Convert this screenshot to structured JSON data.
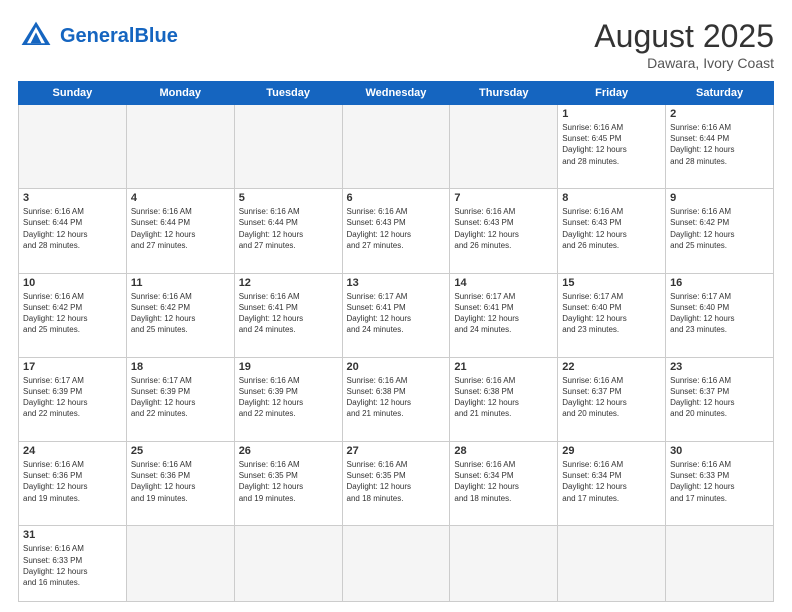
{
  "header": {
    "logo_general": "General",
    "logo_blue": "Blue",
    "month_year": "August 2025",
    "location": "Dawara, Ivory Coast"
  },
  "days_of_week": [
    "Sunday",
    "Monday",
    "Tuesday",
    "Wednesday",
    "Thursday",
    "Friday",
    "Saturday"
  ],
  "weeks": [
    [
      {
        "day": "",
        "info": "",
        "empty": true
      },
      {
        "day": "",
        "info": "",
        "empty": true
      },
      {
        "day": "",
        "info": "",
        "empty": true
      },
      {
        "day": "",
        "info": "",
        "empty": true
      },
      {
        "day": "",
        "info": "",
        "empty": true
      },
      {
        "day": "1",
        "info": "Sunrise: 6:16 AM\nSunset: 6:45 PM\nDaylight: 12 hours\nand 28 minutes.",
        "empty": false
      },
      {
        "day": "2",
        "info": "Sunrise: 6:16 AM\nSunset: 6:44 PM\nDaylight: 12 hours\nand 28 minutes.",
        "empty": false
      }
    ],
    [
      {
        "day": "3",
        "info": "Sunrise: 6:16 AM\nSunset: 6:44 PM\nDaylight: 12 hours\nand 28 minutes.",
        "empty": false
      },
      {
        "day": "4",
        "info": "Sunrise: 6:16 AM\nSunset: 6:44 PM\nDaylight: 12 hours\nand 27 minutes.",
        "empty": false
      },
      {
        "day": "5",
        "info": "Sunrise: 6:16 AM\nSunset: 6:44 PM\nDaylight: 12 hours\nand 27 minutes.",
        "empty": false
      },
      {
        "day": "6",
        "info": "Sunrise: 6:16 AM\nSunset: 6:43 PM\nDaylight: 12 hours\nand 27 minutes.",
        "empty": false
      },
      {
        "day": "7",
        "info": "Sunrise: 6:16 AM\nSunset: 6:43 PM\nDaylight: 12 hours\nand 26 minutes.",
        "empty": false
      },
      {
        "day": "8",
        "info": "Sunrise: 6:16 AM\nSunset: 6:43 PM\nDaylight: 12 hours\nand 26 minutes.",
        "empty": false
      },
      {
        "day": "9",
        "info": "Sunrise: 6:16 AM\nSunset: 6:42 PM\nDaylight: 12 hours\nand 25 minutes.",
        "empty": false
      }
    ],
    [
      {
        "day": "10",
        "info": "Sunrise: 6:16 AM\nSunset: 6:42 PM\nDaylight: 12 hours\nand 25 minutes.",
        "empty": false
      },
      {
        "day": "11",
        "info": "Sunrise: 6:16 AM\nSunset: 6:42 PM\nDaylight: 12 hours\nand 25 minutes.",
        "empty": false
      },
      {
        "day": "12",
        "info": "Sunrise: 6:16 AM\nSunset: 6:41 PM\nDaylight: 12 hours\nand 24 minutes.",
        "empty": false
      },
      {
        "day": "13",
        "info": "Sunrise: 6:17 AM\nSunset: 6:41 PM\nDaylight: 12 hours\nand 24 minutes.",
        "empty": false
      },
      {
        "day": "14",
        "info": "Sunrise: 6:17 AM\nSunset: 6:41 PM\nDaylight: 12 hours\nand 24 minutes.",
        "empty": false
      },
      {
        "day": "15",
        "info": "Sunrise: 6:17 AM\nSunset: 6:40 PM\nDaylight: 12 hours\nand 23 minutes.",
        "empty": false
      },
      {
        "day": "16",
        "info": "Sunrise: 6:17 AM\nSunset: 6:40 PM\nDaylight: 12 hours\nand 23 minutes.",
        "empty": false
      }
    ],
    [
      {
        "day": "17",
        "info": "Sunrise: 6:17 AM\nSunset: 6:39 PM\nDaylight: 12 hours\nand 22 minutes.",
        "empty": false
      },
      {
        "day": "18",
        "info": "Sunrise: 6:17 AM\nSunset: 6:39 PM\nDaylight: 12 hours\nand 22 minutes.",
        "empty": false
      },
      {
        "day": "19",
        "info": "Sunrise: 6:16 AM\nSunset: 6:39 PM\nDaylight: 12 hours\nand 22 minutes.",
        "empty": false
      },
      {
        "day": "20",
        "info": "Sunrise: 6:16 AM\nSunset: 6:38 PM\nDaylight: 12 hours\nand 21 minutes.",
        "empty": false
      },
      {
        "day": "21",
        "info": "Sunrise: 6:16 AM\nSunset: 6:38 PM\nDaylight: 12 hours\nand 21 minutes.",
        "empty": false
      },
      {
        "day": "22",
        "info": "Sunrise: 6:16 AM\nSunset: 6:37 PM\nDaylight: 12 hours\nand 20 minutes.",
        "empty": false
      },
      {
        "day": "23",
        "info": "Sunrise: 6:16 AM\nSunset: 6:37 PM\nDaylight: 12 hours\nand 20 minutes.",
        "empty": false
      }
    ],
    [
      {
        "day": "24",
        "info": "Sunrise: 6:16 AM\nSunset: 6:36 PM\nDaylight: 12 hours\nand 19 minutes.",
        "empty": false
      },
      {
        "day": "25",
        "info": "Sunrise: 6:16 AM\nSunset: 6:36 PM\nDaylight: 12 hours\nand 19 minutes.",
        "empty": false
      },
      {
        "day": "26",
        "info": "Sunrise: 6:16 AM\nSunset: 6:35 PM\nDaylight: 12 hours\nand 19 minutes.",
        "empty": false
      },
      {
        "day": "27",
        "info": "Sunrise: 6:16 AM\nSunset: 6:35 PM\nDaylight: 12 hours\nand 18 minutes.",
        "empty": false
      },
      {
        "day": "28",
        "info": "Sunrise: 6:16 AM\nSunset: 6:34 PM\nDaylight: 12 hours\nand 18 minutes.",
        "empty": false
      },
      {
        "day": "29",
        "info": "Sunrise: 6:16 AM\nSunset: 6:34 PM\nDaylight: 12 hours\nand 17 minutes.",
        "empty": false
      },
      {
        "day": "30",
        "info": "Sunrise: 6:16 AM\nSunset: 6:33 PM\nDaylight: 12 hours\nand 17 minutes.",
        "empty": false
      }
    ],
    [
      {
        "day": "31",
        "info": "Sunrise: 6:16 AM\nSunset: 6:33 PM\nDaylight: 12 hours\nand 16 minutes.",
        "empty": false
      },
      {
        "day": "",
        "info": "",
        "empty": true
      },
      {
        "day": "",
        "info": "",
        "empty": true
      },
      {
        "day": "",
        "info": "",
        "empty": true
      },
      {
        "day": "",
        "info": "",
        "empty": true
      },
      {
        "day": "",
        "info": "",
        "empty": true
      },
      {
        "day": "",
        "info": "",
        "empty": true
      }
    ]
  ]
}
